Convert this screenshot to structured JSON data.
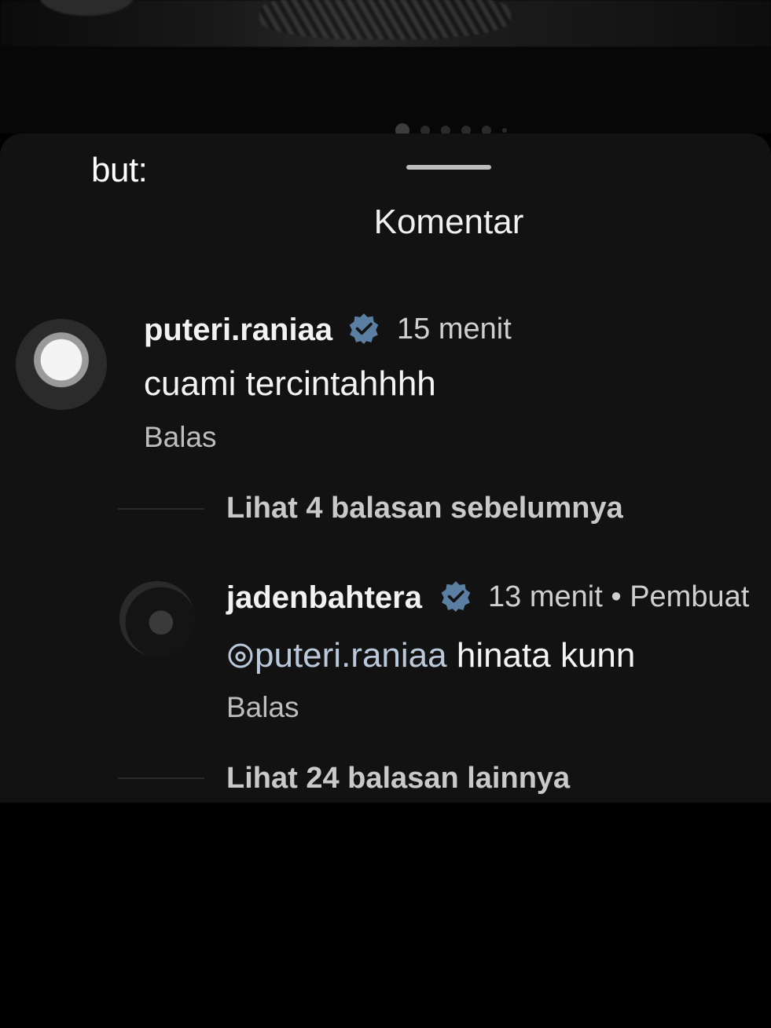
{
  "caption": "but:",
  "sheet": {
    "title": "Komentar"
  },
  "comments": [
    {
      "username": "puteri.raniaa",
      "time": "15 menit",
      "text": "cuami tercintahhhh",
      "reply_label": "Balas"
    }
  ],
  "replies_prev": "Lihat 4 balasan sebelumnya",
  "reply_comment": {
    "username": "jadenbahtera",
    "time": "13 menit",
    "separator": "•",
    "creator_label": "Pembuat",
    "mention_icon": "threads-icon",
    "mention": "puteri.raniaa",
    "text": "hinata kunn",
    "reply_label": "Balas"
  },
  "replies_more": "Lihat 24 balasan lainnya",
  "colors": {
    "verified": "#5b7fa3",
    "background": "#121212"
  }
}
